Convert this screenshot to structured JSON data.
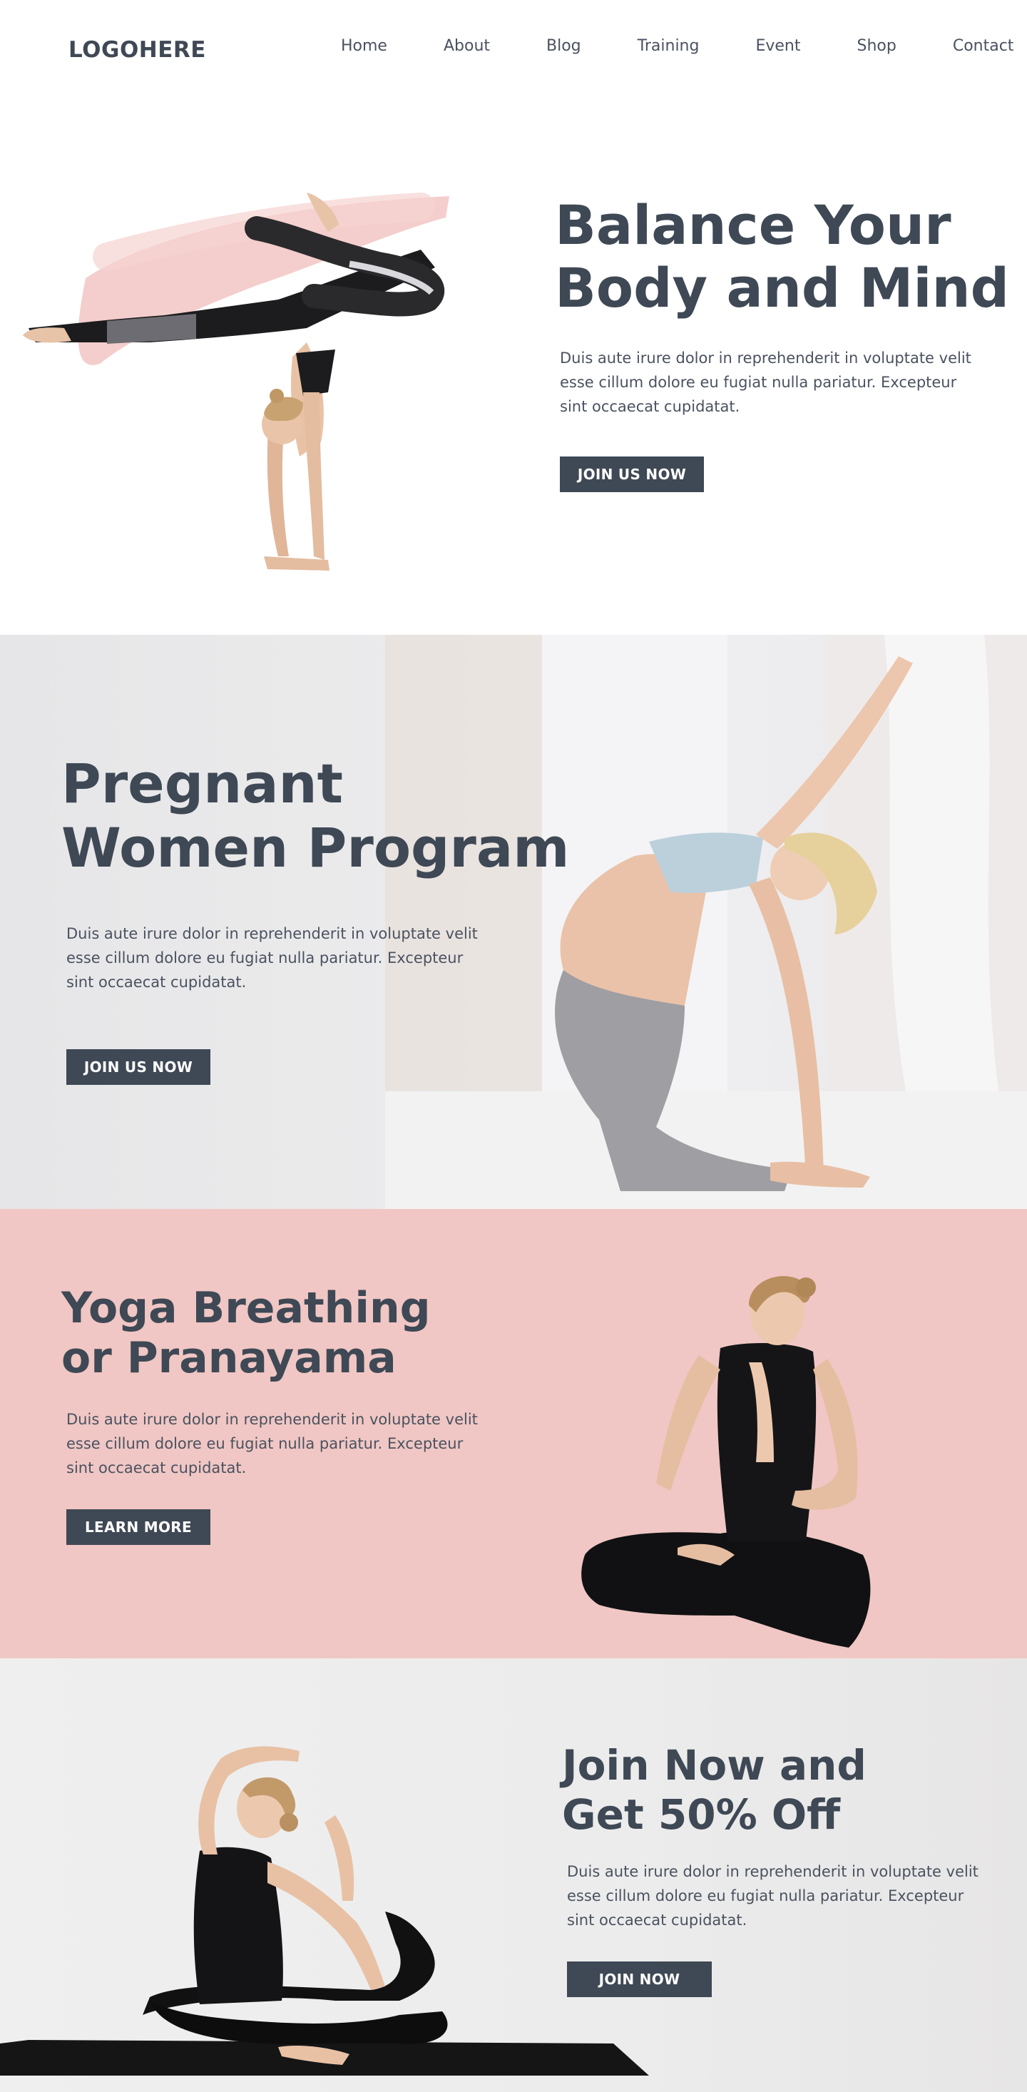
{
  "nav": {
    "logo": "LOGOHERE",
    "items": [
      "Home",
      "About",
      "Blog",
      "Training",
      "Event",
      "Shop",
      "Contact"
    ]
  },
  "hero": {
    "title_line1": "Balance Your",
    "title_line2": "Body and Mind",
    "body": "Duis aute irure dolor in reprehenderit in voluptate velit esse cillum dolore eu fugiat nulla pariatur. Excepteur sint occaecat cupidatat.",
    "button": "JOIN US NOW"
  },
  "pregnant": {
    "title_line1": "Pregnant",
    "title_line2": "Women Program",
    "body": "Duis aute irure dolor in reprehenderit in voluptate velit esse cillum dolore eu fugiat nulla pariatur. Excepteur sint occaecat cupidatat.",
    "button": "JOIN US NOW"
  },
  "breathing": {
    "title_line1": "Yoga Breathing",
    "title_line2": "or Pranayama",
    "body": "Duis aute irure dolor in reprehenderit in voluptate velit esse cillum dolore eu fugiat nulla pariatur. Excepteur sint occaecat cupidatat.",
    "button": "LEARN MORE"
  },
  "join": {
    "title_line1": "Join Now and",
    "title_line2": "Get 50% Off",
    "body": "Duis aute irure dolor in reprehenderit in voluptate velit esse cillum dolore eu fugiat nulla pariatur. Excepteur sint occaecat cupidatat.",
    "button": "JOIN NOW"
  },
  "colors": {
    "text_dark": "#3f4855",
    "button_bg": "#3f4855",
    "pink_section": "#f0c7c4",
    "brush_pink": "#f2c9c6"
  }
}
